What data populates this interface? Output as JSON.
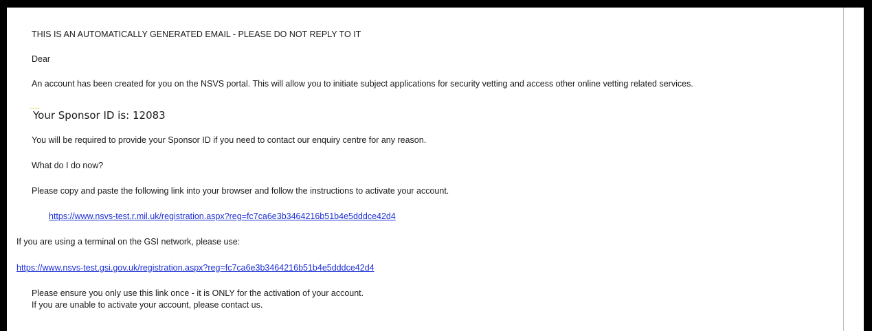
{
  "email": {
    "auto_notice": "THIS IS AN AUTOMATICALLY GENERATED EMAIL - PLEASE DO NOT REPLY TO IT",
    "greeting": "Dear",
    "intro": "An account has been created for you on the NSVS portal. This will allow you to initiate subject applications for security vetting and access other online vetting related services.",
    "sponsor_id_text": "Your Sponsor ID is: 12083",
    "sponsor_requirement": "You will be required to provide your Sponsor ID if you need to contact our enquiry centre for any reason.",
    "what_now": "What do I do now?",
    "copy_instruction": "Please copy and paste the following link into your browser and follow the instructions to activate your account.",
    "primary_link": "https://www.nsvs-test.r.mil.uk/registration.aspx?reg=fc7ca6e3b3464216b51b4e5dddce42d4",
    "gsi_notice": "If you are using a terminal on the GSI network, please use:",
    "gsi_link": "https://www.nsvs-test.gsi.gov.uk/registration.aspx?reg=fc7ca6e3b3464216b51b4e5dddce42d4",
    "once_notice": "Please ensure you only use this link once - it is ONLY for the activation of your account.",
    "contact_notice": "If you are unable to activate your account, please contact us."
  }
}
